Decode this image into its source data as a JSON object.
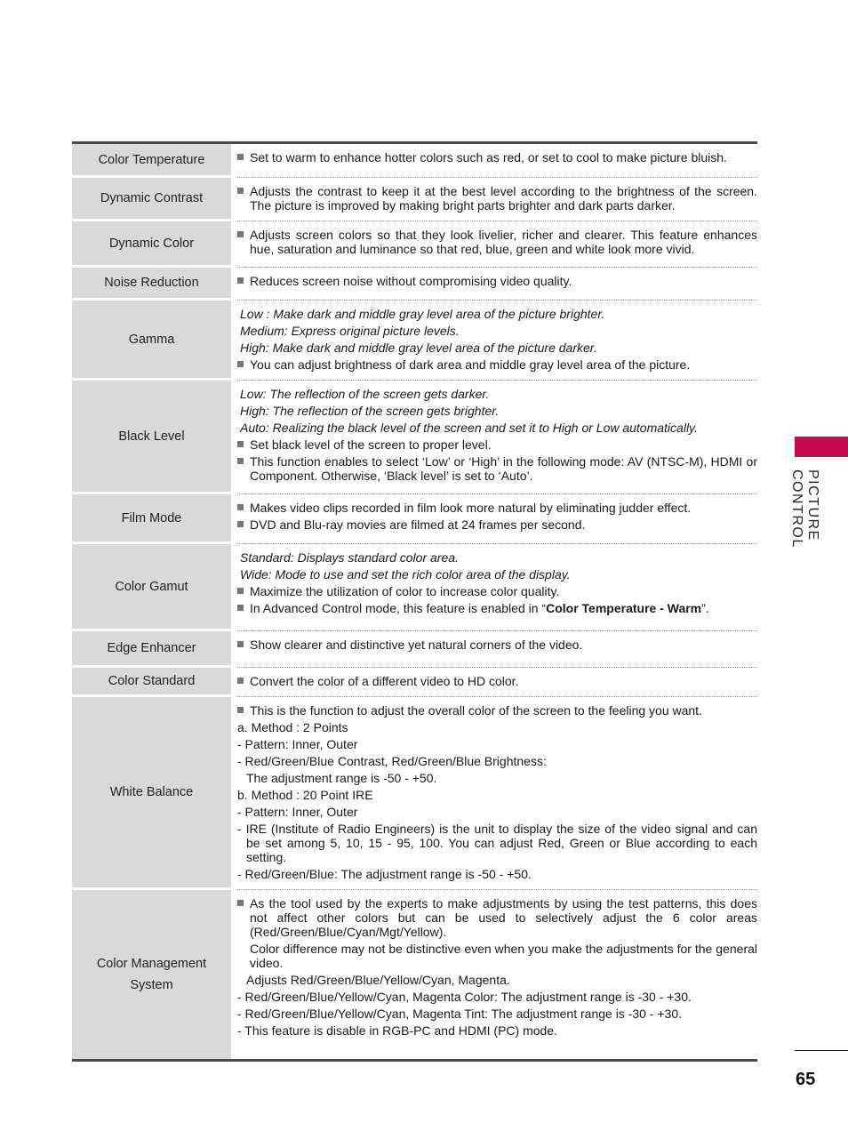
{
  "section": {
    "title": "PICTURE CONTROL",
    "accent_color": "#c8094f"
  },
  "page_number": "65",
  "rows": [
    {
      "label": "Color Temperature",
      "lines": [
        {
          "type": "bullet",
          "text": "Set to warm to enhance hotter colors such as red, or set to cool to make picture bluish."
        }
      ]
    },
    {
      "label": "Dynamic Contrast",
      "lines": [
        {
          "type": "bullet",
          "text": "Adjusts the contrast to keep it at the best level according to the brightness of the screen. The picture is improved by making bright parts brighter and dark parts darker."
        }
      ]
    },
    {
      "label": "Dynamic Color",
      "lines": [
        {
          "type": "bullet",
          "text": "Adjusts screen colors so that they look livelier, richer and clearer. This feature enhances hue, saturation and luminance so that red, blue, green and white look more vivid."
        }
      ]
    },
    {
      "label": "Noise Reduction",
      "lines": [
        {
          "type": "bullet",
          "text": "Reduces screen noise without compromising video quality."
        }
      ]
    },
    {
      "label": "Gamma",
      "lines": [
        {
          "type": "italic",
          "text": "Low : Make dark and middle gray level area of the picture brighter."
        },
        {
          "type": "italic",
          "text": "Medium: Express original picture levels."
        },
        {
          "type": "italic",
          "text": "High: Make dark and middle gray level area of the picture darker."
        },
        {
          "type": "bullet",
          "text": "You can adjust brightness of dark area and middle gray level area of the picture."
        }
      ]
    },
    {
      "label": "Black Level",
      "lines": [
        {
          "type": "italic",
          "text": "Low: The reflection of the screen gets darker."
        },
        {
          "type": "italic",
          "text": "High: The reflection of the screen gets brighter."
        },
        {
          "type": "italic",
          "text": "Auto: Realizing the black level of the screen and set it to High or Low automatically."
        },
        {
          "type": "bullet",
          "text": "Set black level of the screen to proper level."
        },
        {
          "type": "bullet",
          "text": "This function enables to select ‘Low’ or ‘High’ in the following mode: AV (NTSC-M), HDMI or Component. Otherwise, ‘Black level’ is set to ‘Auto’."
        }
      ]
    },
    {
      "label": "Film Mode",
      "lines": [
        {
          "type": "bullet",
          "text": "Makes video clips recorded in film look more natural by eliminating judder effect."
        },
        {
          "type": "bullet",
          "text": "DVD and Blu-ray movies are filmed at 24 frames per second."
        }
      ]
    },
    {
      "label": "Color Gamut",
      "lines": [
        {
          "type": "italic",
          "text": "Standard: Displays standard color area."
        },
        {
          "type": "italic",
          "text": "Wide: Mode to use and set the rich color area of the display."
        },
        {
          "type": "bullet",
          "text": "Maximize the utilization of color to increase color quality."
        },
        {
          "type": "bullet",
          "text": "In Advanced Control mode, this feature is enabled in “",
          "bold": "Color Temperature - Warm",
          "after": "”."
        }
      ]
    },
    {
      "label": "Edge Enhancer",
      "lines": [
        {
          "type": "bullet",
          "text": "Show clearer and distinctive yet natural corners of the video."
        }
      ]
    },
    {
      "label": "Color Standard",
      "lines": [
        {
          "type": "bullet",
          "text": "Convert the color of a different video to HD color."
        }
      ]
    },
    {
      "label": "White Balance",
      "lines": [
        {
          "type": "bullet",
          "text": "This is the function to adjust the overall color of the screen to the feeling you want."
        },
        {
          "type": "plain",
          "text": "a. Method : 2 Points"
        },
        {
          "type": "dash",
          "text": "- Pattern: Inner, Outer"
        },
        {
          "type": "dash",
          "text": "- Red/Green/Blue Contrast, Red/Green/Blue Brightness:"
        },
        {
          "type": "indent",
          "text": "The adjustment range is -50 - +50."
        },
        {
          "type": "plain",
          "text": "b. Method : 20 Point IRE"
        },
        {
          "type": "dash",
          "text": "- Pattern: Inner, Outer"
        },
        {
          "type": "dash",
          "text": "- IRE (Institute of Radio Engineers) is the unit to display the size of the video signal and can be set among 5, 10, 15 - 95, 100. You can adjust Red, Green or Blue according to each setting."
        },
        {
          "type": "dash",
          "text": "- Red/Green/Blue: The adjustment range is -50 - +50."
        }
      ]
    },
    {
      "label": "Color Management System",
      "lines": [
        {
          "type": "bullet",
          "text": "As the tool used by the experts to make adjustments by using the test patterns, this does not affect other colors but can be used to selectively adjust the 6 color areas (Red/Green/Blue/Cyan/Mgt/Yellow)."
        },
        {
          "type": "indent2",
          "text": "Color difference may not be distinctive even when you make the adjustments for the general video."
        },
        {
          "type": "indent",
          "text": "Adjusts Red/Green/Blue/Yellow/Cyan, Magenta."
        },
        {
          "type": "dash",
          "text": "- Red/Green/Blue/Yellow/Cyan, Magenta Color: The adjustment range is -30 - +30."
        },
        {
          "type": "dash",
          "text": "- Red/Green/Blue/Yellow/Cyan, Magenta Tint: The adjustment range is -30 - +30."
        },
        {
          "type": "dash",
          "text": "- This feature is disable in RGB-PC and HDMI (PC) mode."
        }
      ]
    }
  ]
}
